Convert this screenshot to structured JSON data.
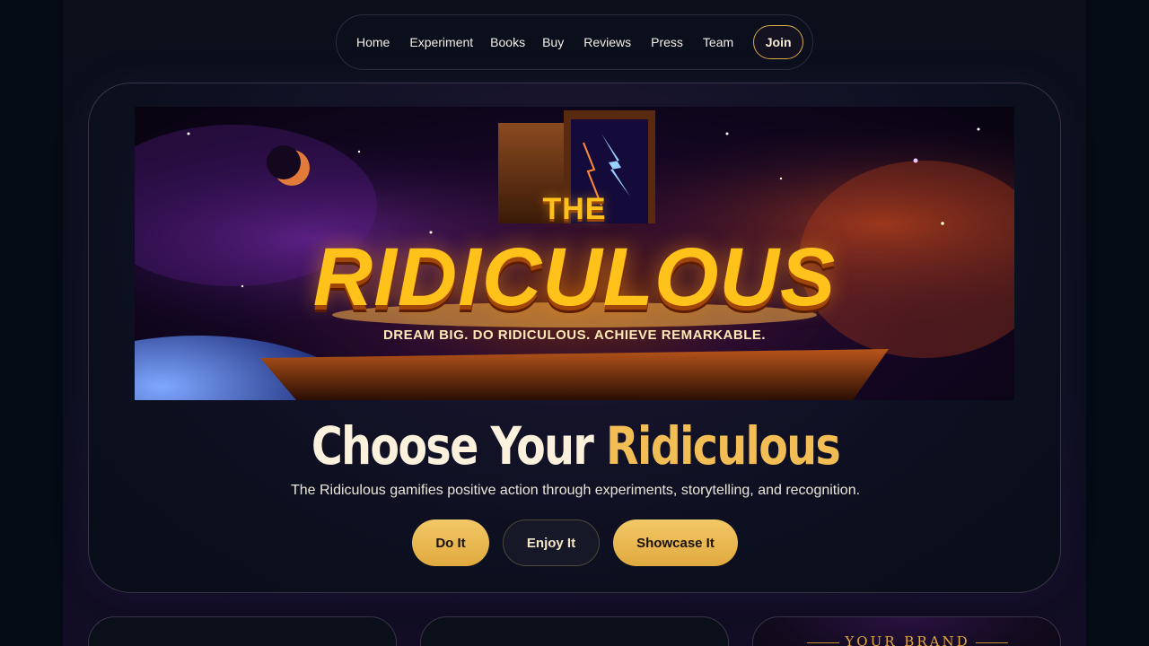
{
  "nav": {
    "items": [
      "Home",
      "Experiment",
      "Books",
      "Buy",
      "Reviews",
      "Press",
      "Team"
    ],
    "join_label": "Join"
  },
  "banner": {
    "the": "THE",
    "title": "RIDICULOUS",
    "tagline": "DREAM BIG. DO RIDICULOUS. ACHIEVE REMARKABLE."
  },
  "hero": {
    "headline_part1": "Choose Your ",
    "headline_accent": "Ridiculous",
    "subtitle": "The Ridiculous gamifies positive action through experiments, storytelling, and recognition.",
    "buttons": {
      "do_it": "Do It",
      "enjoy_it": "Enjoy It",
      "showcase_it": "Showcase It"
    }
  },
  "cards": {
    "brand_label": "YOUR BRAND"
  },
  "colors": {
    "accent_gold": "#f2bd55",
    "background": "#050b14"
  }
}
